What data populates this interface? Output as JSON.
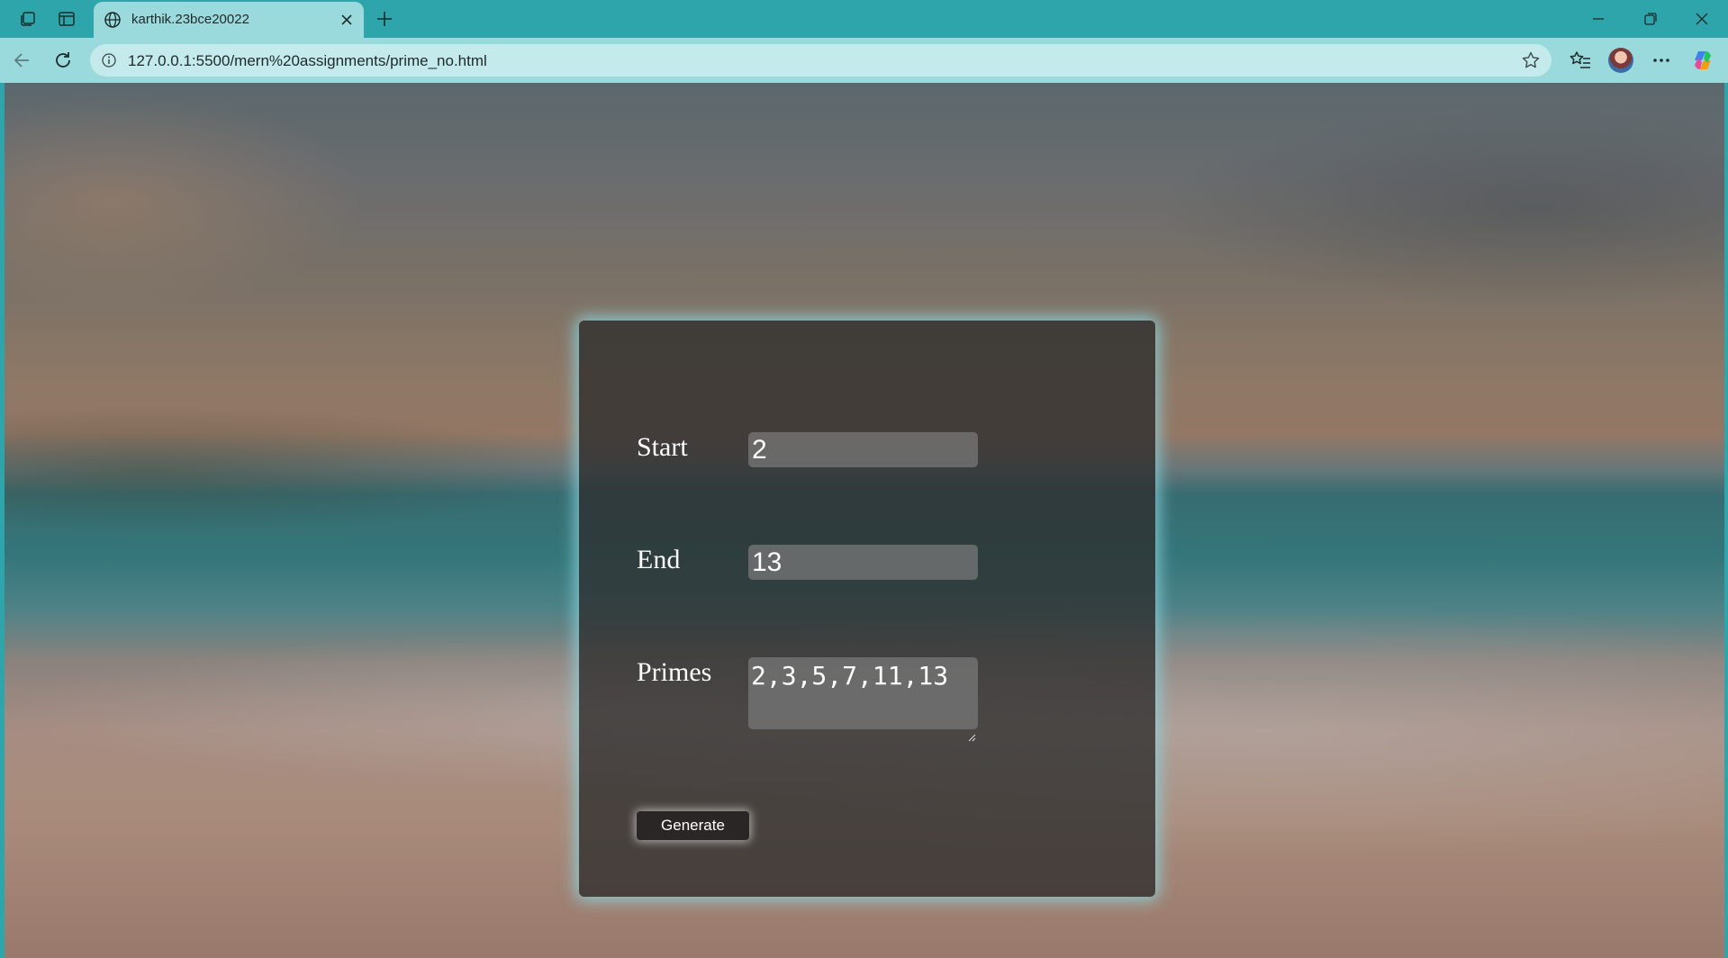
{
  "browser": {
    "tab": {
      "title": "karthik.23bce20022"
    },
    "address_bar": {
      "url": "127.0.0.1:5500/mern%20assignments/prime_no.html"
    }
  },
  "form": {
    "start": {
      "label": "Start",
      "value": "2"
    },
    "end": {
      "label": "End",
      "value": "13"
    },
    "primes": {
      "label": "Primes",
      "value": "2,3,5,7,11,13"
    },
    "generate_label": "Generate"
  },
  "colors": {
    "chrome_teal": "#2ea5ab",
    "toolbar": "#9ad9dc",
    "card_glow": "#8cd7e1",
    "button": "#2b2626"
  },
  "icons": [
    "workspaces-icon",
    "tab-actions-icon",
    "globe-icon",
    "close-icon",
    "plus-icon",
    "minimize-icon",
    "restore-icon",
    "window-close-icon",
    "back-icon",
    "refresh-icon",
    "info-icon",
    "star-icon",
    "favorites-icon",
    "more-icon",
    "copilot-icon"
  ]
}
